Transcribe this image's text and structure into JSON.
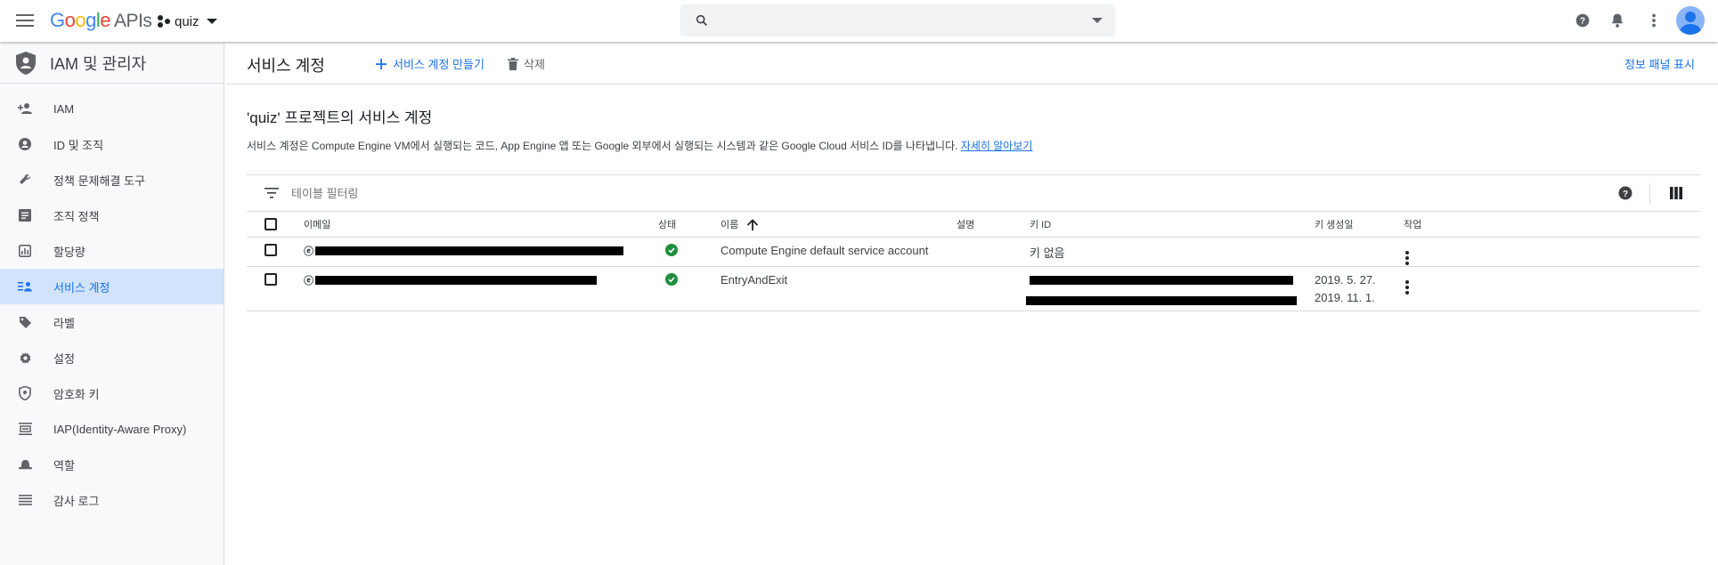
{
  "topbar": {
    "logo": {
      "g1": "G",
      "g2": "o",
      "g3": "o",
      "g4": "g",
      "g5": "l",
      "g6": "e",
      "apis": "APIs"
    },
    "project": "quiz",
    "search_placeholder": ""
  },
  "sidebar": {
    "title": "IAM 및 관리자",
    "items": [
      {
        "label": "IAM",
        "icon": "person-add-icon"
      },
      {
        "label": "ID 및 조직",
        "icon": "account-circle-icon"
      },
      {
        "label": "정책 문제해결 도구",
        "icon": "wrench-icon"
      },
      {
        "label": "조직 정책",
        "icon": "list-box-icon"
      },
      {
        "label": "할당량",
        "icon": "gauge-icon"
      },
      {
        "label": "서비스 계정",
        "icon": "service-account-icon",
        "active": true
      },
      {
        "label": "라벨",
        "icon": "label-icon"
      },
      {
        "label": "설정",
        "icon": "gear-icon"
      },
      {
        "label": "암호화 키",
        "icon": "shield-key-icon"
      },
      {
        "label": "IAP(Identity-Aware Proxy)",
        "icon": "proxy-icon"
      },
      {
        "label": "역할",
        "icon": "hat-icon"
      },
      {
        "label": "감사 로그",
        "icon": "lines-icon"
      }
    ]
  },
  "actionbar": {
    "title": "서비스 계정",
    "create_label": "서비스 계정 만들기",
    "delete_label": "삭제",
    "info_panel_label": "정보 패널 표시"
  },
  "content": {
    "section_title": "'quiz' 프로젝트의 서비스 계정",
    "description": "서비스 계정은 Compute Engine VM에서 실행되는 코드, App Engine 앱 또는 Google 외부에서 실행되는 시스템과 같은 Google Cloud 서비스 ID를 나타냅니다.",
    "learn_more": "자세히 알아보기",
    "filter_placeholder": "테이블 필터링"
  },
  "table": {
    "headers": {
      "email": "이메일",
      "status": "상태",
      "name": "이름",
      "description": "설명",
      "key_id": "키 ID",
      "key_created": "키 생성일",
      "actions": "작업"
    },
    "rows": [
      {
        "name": "Compute Engine default service account",
        "description": "",
        "key_id": "키 없음",
        "key_created": [],
        "status": "enabled"
      },
      {
        "name": "EntryAndExit",
        "description": "",
        "key_id": "",
        "key_created": [
          "2019. 5. 27.",
          "2019. 11. 1."
        ],
        "status": "enabled"
      }
    ]
  },
  "colors": {
    "accent": "#1a73e8",
    "success": "#1e8e3e",
    "active_bg": "#d2e3fc"
  }
}
